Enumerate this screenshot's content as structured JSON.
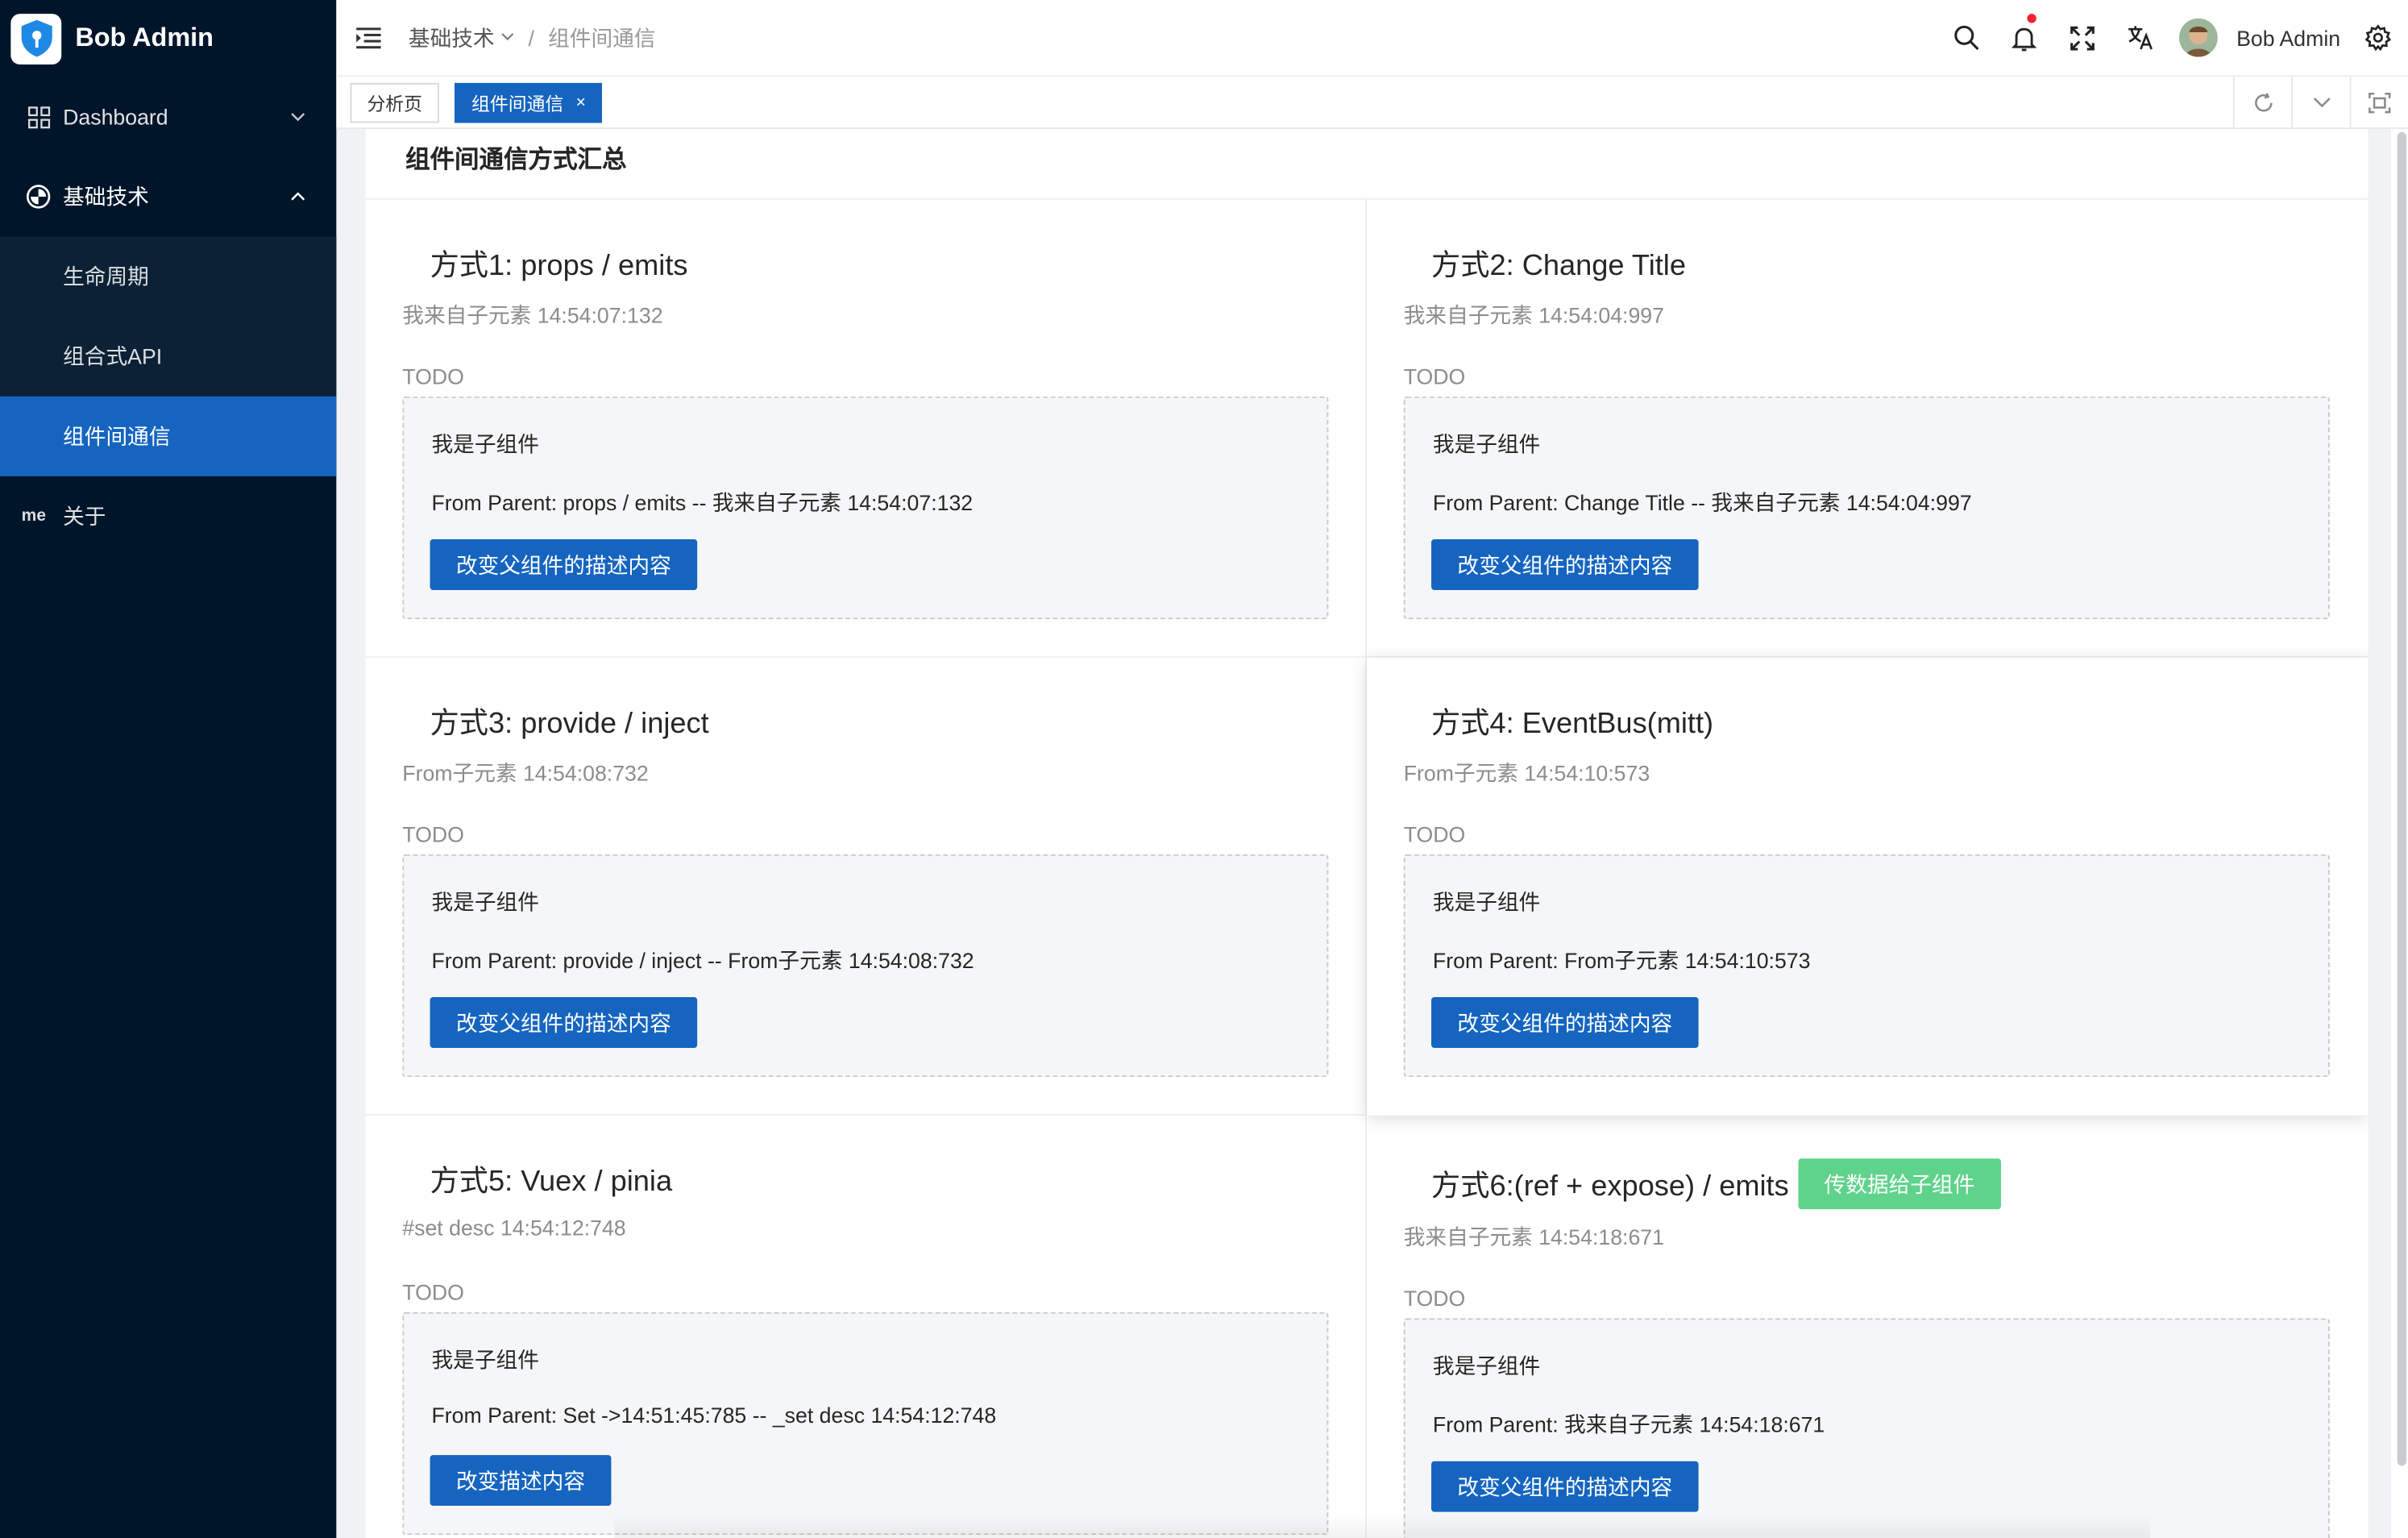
{
  "brand": {
    "title": "Bob Admin"
  },
  "sidebar": {
    "items": [
      {
        "label": "Dashboard"
      },
      {
        "label": "基础技术"
      },
      {
        "label": "关于",
        "prefix": "me"
      }
    ],
    "submenu": [
      {
        "label": "生命周期"
      },
      {
        "label": "组合式API"
      },
      {
        "label": "组件间通信"
      }
    ]
  },
  "header": {
    "breadcrumb": [
      "基础技术",
      "组件间通信"
    ],
    "separator": "/",
    "username": "Bob Admin"
  },
  "tabs": [
    {
      "label": "分析页"
    },
    {
      "label": "组件间通信",
      "close": "×"
    }
  ],
  "page": {
    "title": "组件间通信方式汇总"
  },
  "cells": [
    {
      "title": "方式1: props / emits",
      "desc": "我来自子元素 14:54:07:132",
      "todo": "TODO",
      "child_title": "我是子组件",
      "child_from": "From Parent: props / emits -- 我来自子元素 14:54:07:132",
      "button": "改变父组件的描述内容"
    },
    {
      "title": "方式2: Change Title",
      "desc": "我来自子元素 14:54:04:997",
      "todo": "TODO",
      "child_title": "我是子组件",
      "child_from": "From Parent: Change Title -- 我来自子元素 14:54:04:997",
      "button": "改变父组件的描述内容"
    },
    {
      "title": "方式3: provide / inject",
      "desc": "From子元素 14:54:08:732",
      "todo": "TODO",
      "child_title": "我是子组件",
      "child_from": "From Parent: provide / inject -- From子元素 14:54:08:732",
      "button": "改变父组件的描述内容"
    },
    {
      "title": "方式4: EventBus(mitt)",
      "desc": "From子元素 14:54:10:573",
      "todo": "TODO",
      "child_title": "我是子组件",
      "child_from": "From Parent: From子元素 14:54:10:573",
      "button": "改变父组件的描述内容"
    },
    {
      "title": "方式5: Vuex / pinia",
      "desc": "#set desc 14:54:12:748",
      "todo": "TODO",
      "child_title": "我是子组件",
      "child_from": "From Parent: Set ->14:51:45:785 -- _set desc 14:54:12:748",
      "button": "改变描述内容"
    },
    {
      "title": "方式6:(ref + expose) / emits",
      "title_button": "传数据给子组件",
      "desc": "我来自子元素 14:54:18:671",
      "todo": "TODO",
      "child_title": "我是子组件",
      "child_from": "From Parent: 我来自子元素 14:54:18:671",
      "button": "改变父组件的描述内容"
    }
  ],
  "colors": {
    "sidebar_bg": "#001529",
    "primary": "#1565c0",
    "green_button": "#5fd38b",
    "notification_dot": "#f5222d"
  }
}
